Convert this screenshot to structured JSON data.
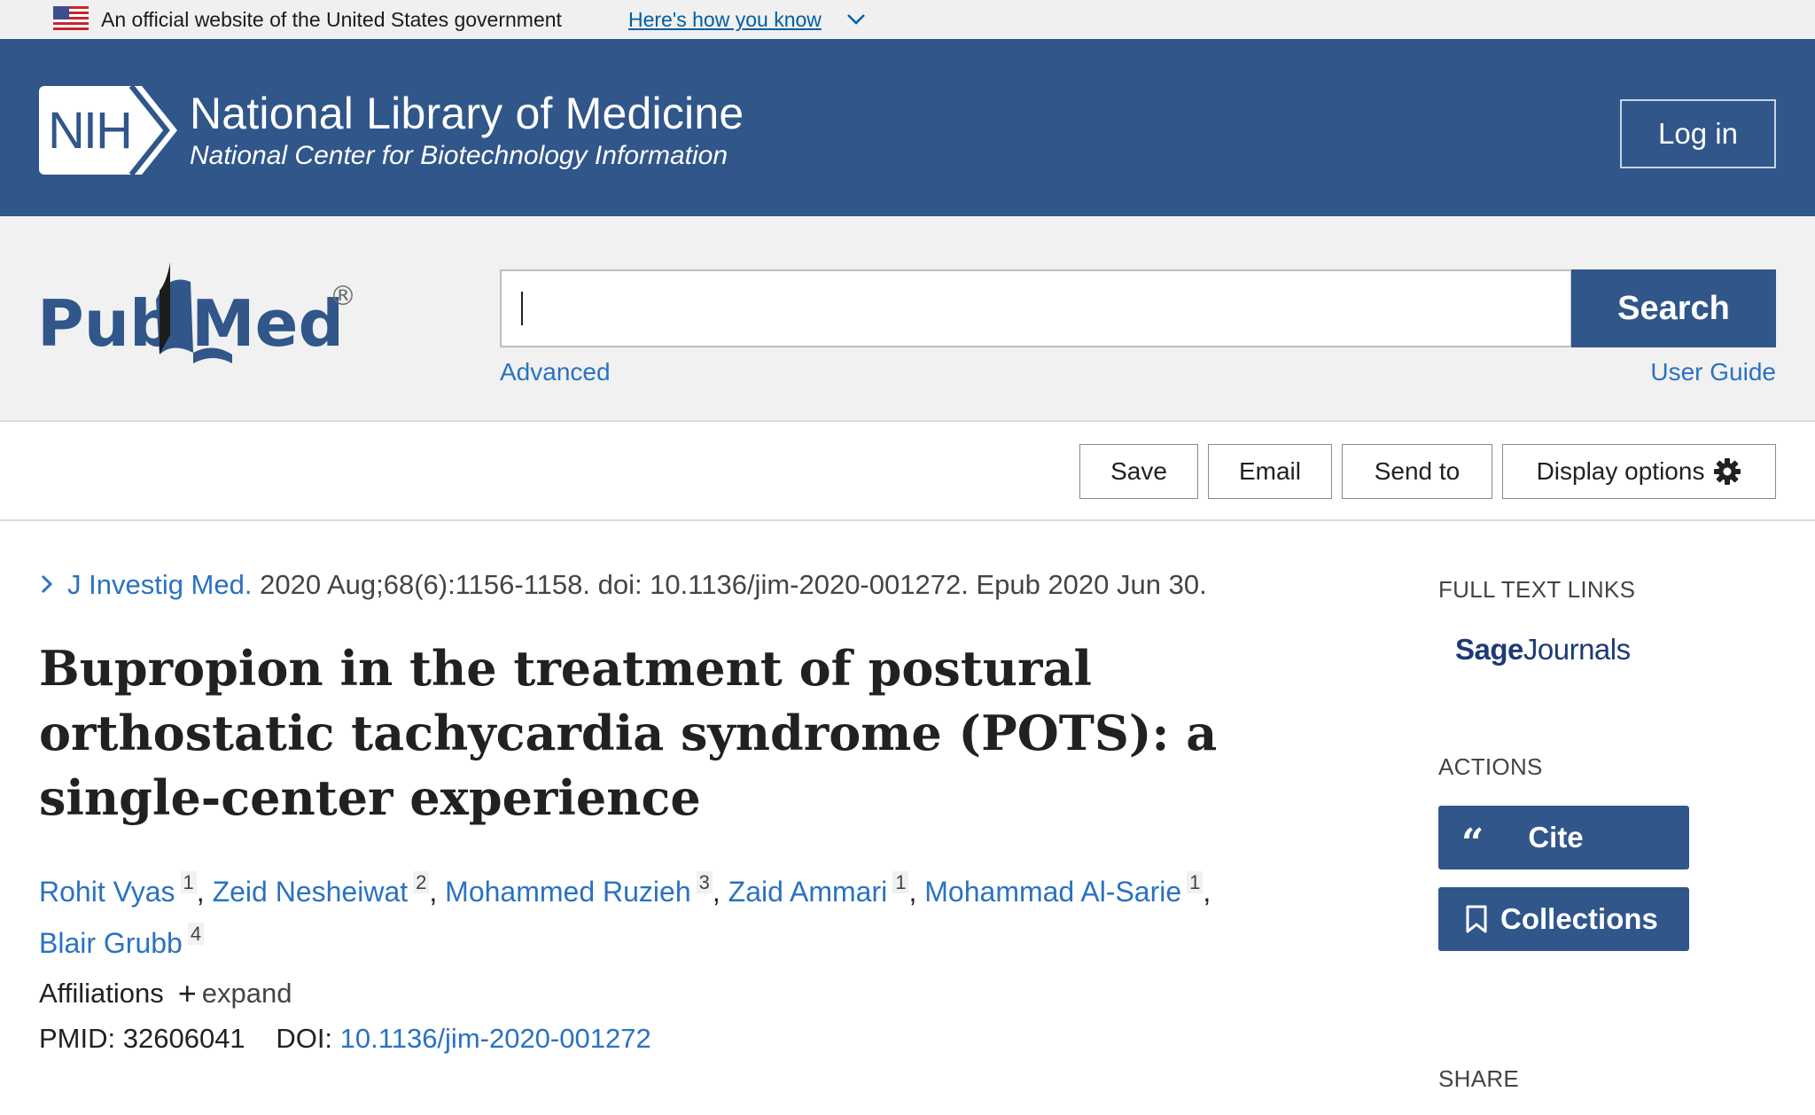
{
  "gov_banner": {
    "text": "An official website of the United States government",
    "link": "Here's how you know"
  },
  "nih_header": {
    "logo_text": "NIH",
    "title": "National Library of Medicine",
    "subtitle": "National Center for Biotechnology Information",
    "login_label": "Log in"
  },
  "search": {
    "logo_text_left": "Pub",
    "logo_text_right": "Med",
    "logo_mark": "®",
    "input_value": "",
    "button_label": "Search",
    "advanced_label": "Advanced",
    "user_guide_label": "User Guide"
  },
  "toolbar": {
    "save_label": "Save",
    "email_label": "Email",
    "send_to_label": "Send to",
    "display_options_label": "Display options"
  },
  "article": {
    "journal": "J Investig Med.",
    "citation": " 2020 Aug;68(6):1156-1158. doi: 10.1136/jim-2020-001272. Epub 2020 Jun 30.",
    "title": "Bupropion in the treatment of postural orthostatic tachycardia syndrome (POTS): a single-center experience",
    "authors": [
      {
        "name": "Rohit Vyas",
        "aff": "1"
      },
      {
        "name": "Zeid Nesheiwat",
        "aff": "2"
      },
      {
        "name": "Mohammed Ruzieh",
        "aff": "3"
      },
      {
        "name": "Zaid Ammari",
        "aff": "1"
      },
      {
        "name": "Mohammad Al-Sarie",
        "aff": "1"
      },
      {
        "name": "Blair Grubb",
        "aff": "4"
      }
    ],
    "affiliations_label": "Affiliations",
    "expand_label": "expand",
    "pmid_label": "PMID:",
    "pmid": "32606041",
    "doi_label": "DOI:",
    "doi": "10.1136/jim-2020-001272"
  },
  "sidebar": {
    "full_text_heading": "FULL TEXT LINKS",
    "sage_bold": "Sage",
    "sage_rest": "Journals",
    "actions_heading": "ACTIONS",
    "cite_label": "Cite",
    "collections_label": "Collections",
    "share_heading": "SHARE"
  },
  "colors": {
    "nih_blue": "#30568a",
    "link_blue": "#2a72c0",
    "banner_gray": "#f0f0f0"
  }
}
